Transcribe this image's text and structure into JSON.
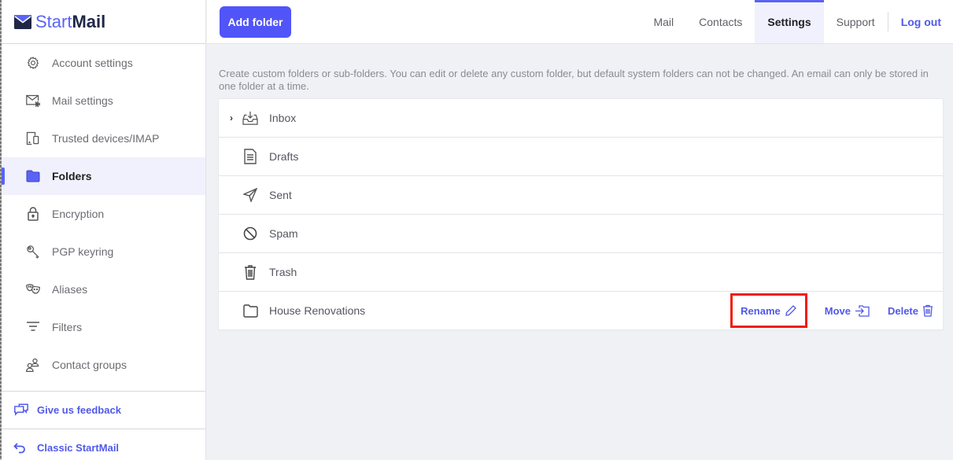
{
  "brand": {
    "start": "Start",
    "mail": "Mail"
  },
  "sidebar": {
    "items": [
      {
        "label": "Account settings",
        "icon": "gear-icon",
        "active": false
      },
      {
        "label": "Mail settings",
        "icon": "mail-settings-icon",
        "active": false
      },
      {
        "label": "Trusted devices/IMAP",
        "icon": "devices-icon",
        "active": false
      },
      {
        "label": "Folders",
        "icon": "folder-icon",
        "active": true
      },
      {
        "label": "Encryption",
        "icon": "lock-icon",
        "active": false
      },
      {
        "label": "PGP keyring",
        "icon": "key-icon",
        "active": false
      },
      {
        "label": "Aliases",
        "icon": "masks-icon",
        "active": false
      },
      {
        "label": "Filters",
        "icon": "filter-icon",
        "active": false
      },
      {
        "label": "Contact groups",
        "icon": "contact-groups-icon",
        "active": false
      }
    ],
    "links": [
      {
        "label": "Give us feedback",
        "icon": "feedback-icon"
      },
      {
        "label": "Classic StartMail",
        "icon": "back-arrow-icon"
      }
    ]
  },
  "toolbar": {
    "add_folder_label": "Add folder"
  },
  "topnav": {
    "tabs": [
      {
        "label": "Mail",
        "active": false
      },
      {
        "label": "Contacts",
        "active": false
      },
      {
        "label": "Settings",
        "active": true
      },
      {
        "label": "Support",
        "active": false
      }
    ],
    "logout_label": "Log out"
  },
  "main": {
    "description": "Create custom folders or sub-folders. You can edit or delete any custom folder, but default system folders can not be changed. An email can only be stored in one folder at a time.",
    "folders": [
      {
        "name": "Inbox",
        "icon": "inbox-icon",
        "expandable": true
      },
      {
        "name": "Drafts",
        "icon": "drafts-icon",
        "expandable": false
      },
      {
        "name": "Sent",
        "icon": "sent-icon",
        "expandable": false
      },
      {
        "name": "Spam",
        "icon": "spam-icon",
        "expandable": false
      },
      {
        "name": "Trash",
        "icon": "trash-icon",
        "expandable": false
      },
      {
        "name": "House Renovations",
        "icon": "folder-icon",
        "expandable": false
      }
    ],
    "actions": {
      "rename": "Rename",
      "move": "Move",
      "delete": "Delete"
    }
  },
  "colors": {
    "accent": "#5155f7",
    "highlight": "#f01e0f"
  }
}
